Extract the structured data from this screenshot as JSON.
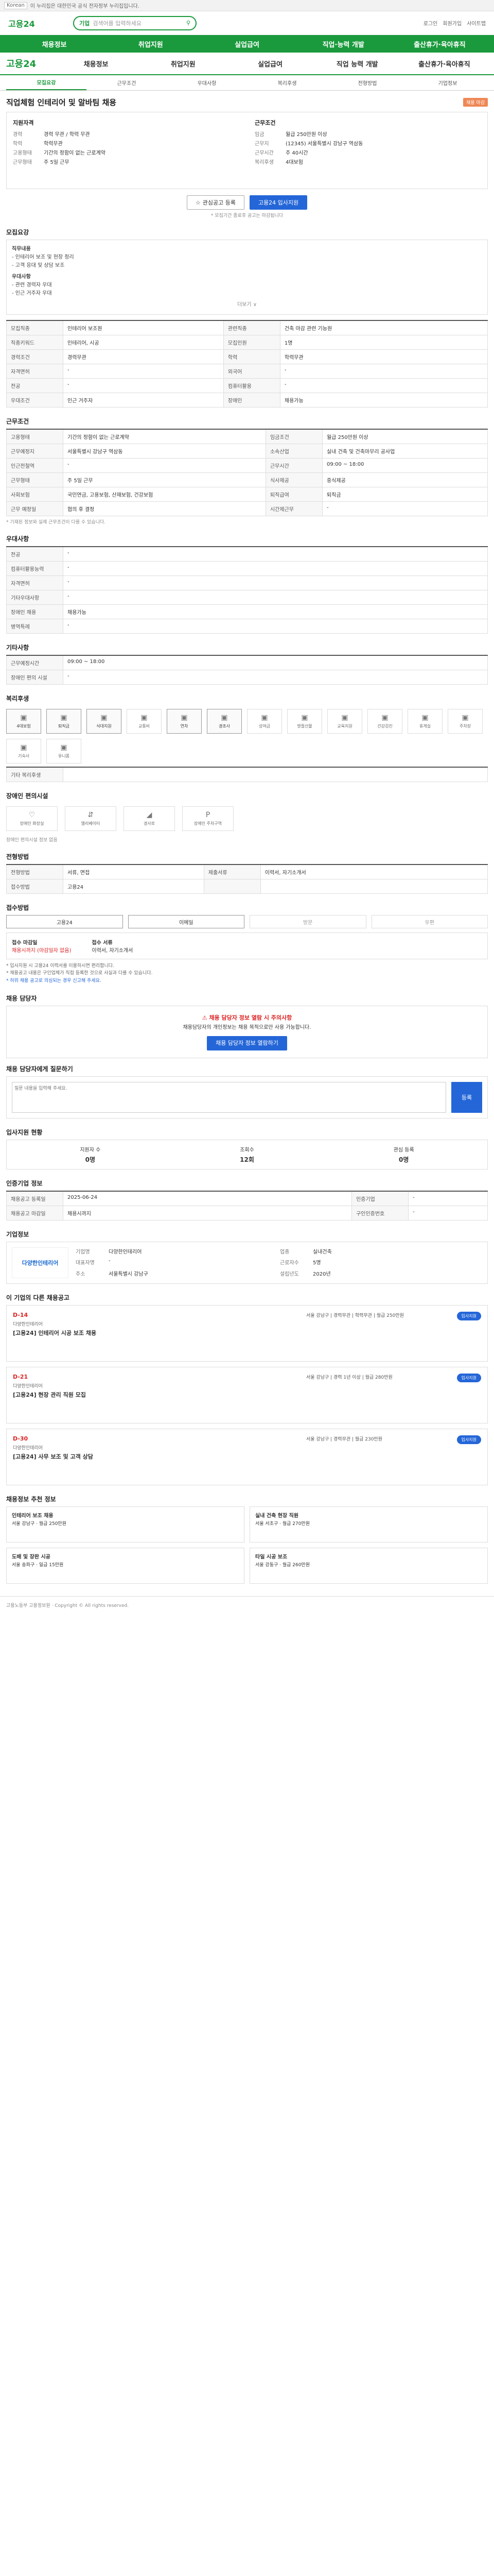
{
  "topbar": {
    "text": "이 누리집은 대한민국 공식 전자정부 누리집입니다.",
    "mini": "Korean"
  },
  "header": {
    "logo": "고용24",
    "search_label": "기업",
    "search_placeholder": "검색어를 입력하세요",
    "links": [
      "로그인",
      "회원가입",
      "사이트맵"
    ]
  },
  "nav": [
    "채용정보",
    "취업지원",
    "실업급여",
    "직업·능력 개발",
    "출산휴가·육아휴직"
  ],
  "gnb": {
    "brand": "고용24",
    "items": [
      "채용정보",
      "취업지원",
      "실업급여",
      "직업 능력 개발",
      "출산휴가·육아휴직"
    ]
  },
  "tabs": [
    "모집요강",
    "근무조건",
    "우대사항",
    "복리후생",
    "전형방법",
    "기업정보"
  ],
  "job": {
    "title": "직업체험 인테리어 및 알바팀 채용",
    "badge": "채용 마감",
    "left_title": "지원자격",
    "left": [
      {
        "k": "경력",
        "v": "경력 무관 / 학력 무관"
      },
      {
        "k": "학력",
        "v": "학력무관"
      },
      {
        "k": "고용형태",
        "v": "기간의 정함이 없는 근로계약"
      },
      {
        "k": "근무형태",
        "v": "주 5일 근무"
      }
    ],
    "right_title": "근무조건",
    "right": [
      {
        "k": "임금",
        "v": "월급 250만원 이상"
      },
      {
        "k": "근무지",
        "v": "(12345) 서울특별시 강남구 역삼동"
      },
      {
        "k": "근무시간",
        "v": "주 40시간"
      },
      {
        "k": "복리후생",
        "v": "4대보험"
      }
    ],
    "scrap_button": "관심공고 등록",
    "apply_button": "고용24 입사지원",
    "note": "* 모집기간 종료후 공고는 마감됩니다"
  },
  "sections": {
    "recruit": "모집요강",
    "recruit_text": [
      "직무내용",
      "- 인테리어 보조 및 현장 정리",
      "- 고객 응대 및 상담 보조",
      "우대사항",
      "- 관련 경력자 우대",
      "- 인근 거주자 우대"
    ],
    "recruit_foot": "더보기 ∨",
    "recruit_table": [
      {
        "k": "모집직종",
        "v": "인테리어 보조원",
        "k2": "관련직종",
        "v2": "건축 마감 관련 기능원"
      },
      {
        "k": "직종키워드",
        "v": "인테리어, 시공",
        "k2": "모집인원",
        "v2": "1명"
      },
      {
        "k": "경력조건",
        "v": "경력무관",
        "k2": "학력",
        "v2": "학력무관"
      },
      {
        "k": "자격면허",
        "v": "-",
        "k2": "외국어",
        "v2": "-"
      },
      {
        "k": "전공",
        "v": "-",
        "k2": "컴퓨터활용",
        "v2": "-"
      },
      {
        "k": "우대조건",
        "v": "인근 거주자",
        "k2": "장애인",
        "v2": "채용가능"
      }
    ],
    "work": "근무조건",
    "work_table": [
      {
        "k": "고용형태",
        "v": "기간의 정함이 없는 근로계약",
        "k2": "임금조건",
        "v2": "월급 250만원 이상"
      },
      {
        "k": "근무예정지",
        "v": "서울특별시 강남구 역삼동",
        "k2": "소속산업",
        "v2": "실내 건축 및 건축마무리 공사업"
      },
      {
        "k": "인근전철역",
        "v": "-",
        "k2": "근무시간",
        "v2": "09:00 ~ 18:00"
      },
      {
        "k": "근무형태",
        "v": "주 5일 근무",
        "k2": "식사제공",
        "v2": "중식제공"
      },
      {
        "k": "사회보험",
        "v": "국민연금, 고용보험, 산재보험, 건강보험",
        "k2": "퇴직급여",
        "v2": "퇴직금"
      },
      {
        "k": "근무 예정일",
        "v": "협의 후 결정",
        "k2": "시간제근무",
        "v2": "-"
      }
    ],
    "work_note": "* 기재된 정보와 실제 근무조건이 다를 수 있습니다.",
    "benefit": "우대사항",
    "benefit_table": [
      {
        "k": "전공",
        "v": "-"
      },
      {
        "k": "컴퓨터활용능력",
        "v": "-"
      },
      {
        "k": "자격면허",
        "v": "-"
      },
      {
        "k": "기타우대사항",
        "v": "-"
      },
      {
        "k": "장애인 채용",
        "v": "채용가능"
      },
      {
        "k": "병역특례",
        "v": "-"
      }
    ],
    "etc": "기타사항",
    "etc_table": [
      {
        "k": "근무예정시간",
        "v": "09:00 ~ 18:00"
      },
      {
        "k": "장애인 편의 시설",
        "v": "-"
      }
    ],
    "welfare": "복리후생",
    "welfare_icons": [
      "4대보험",
      "퇴직금",
      "식대지원",
      "교통비",
      "연차",
      "경조사",
      "상여금",
      "명절선물",
      "교육지원",
      "건강검진",
      "휴게실",
      "주차장",
      "기숙사",
      "유니폼"
    ],
    "welfare_on": [
      0,
      1,
      2,
      4,
      5
    ],
    "welfare_etc": "기타 복리후생",
    "disabled": "장애인 편의시설",
    "disabled_icons": [
      "장애인 화장실",
      "엘리베이터",
      "경사로",
      "장애인 주차구역"
    ],
    "disabled_note": "장애인 편의시설 정보 없음",
    "process": "전형방법",
    "process_table": [
      {
        "k": "전형방법",
        "v": "서류, 면접",
        "k2": "제출서류",
        "v2": "이력서, 자기소개서"
      },
      {
        "k": "접수방법",
        "v": "고용24",
        "k2": "",
        "v2": ""
      }
    ],
    "apply": "접수방법",
    "methods": [
      "고용24",
      "이메일",
      "방문",
      "우편"
    ],
    "methods_on": [
      0,
      1
    ],
    "apply_left_k": "접수 마감일",
    "apply_left_v": "채용시까지 (마감일자 없음)",
    "apply_right_k": "접수 서류",
    "apply_right_v": "이력서, 자기소개서",
    "apply_notes": [
      "* 입사지원 시 고용24 이력서를 이용하시면 편리합니다.",
      "* 채용공고 내용은 구인업체가 직접 등록한 것으로 사실과 다를 수 있습니다.",
      "* 허위 채용 공고로 의심되는 경우 신고해 주세요."
    ],
    "contact": "채용 담당자",
    "warn_title": "채용 담당자 정보 열람 시 주의사항",
    "warn_text": "채용담당자의 개인정보는 채용 목적으로만 사용 가능합니다.",
    "warn_buttons": [
      "채용 담당자 정보 열람하기"
    ],
    "qa": "채용 담당자에게 질문하기",
    "qa_placeholder": "질문 내용을 입력해 주세요.",
    "qa_send": "등록",
    "status": "입사지원 현황",
    "status_items": [
      {
        "k": "지원자 수",
        "v": "0명"
      },
      {
        "k": "조회수",
        "v": "12회"
      },
      {
        "k": "관심 등록",
        "v": "0명"
      }
    ],
    "info": "인증기업 정보",
    "info_table": [
      {
        "k": "채용공고 등록일",
        "v": "2025-06-24",
        "k2": "인증기업",
        "v2": "-"
      },
      {
        "k": "채용공고 마감일",
        "v": "채용시까지",
        "k2": "구인인증번호",
        "v2": "-"
      }
    ],
    "company": "기업정보",
    "company_logo": "다양한인테리어",
    "company_info": [
      {
        "k": "기업명",
        "v": "다양한인테리어"
      },
      {
        "k": "업종",
        "v": "실내건축"
      },
      {
        "k": "대표자명",
        "v": "-"
      },
      {
        "k": "근로자수",
        "v": "5명"
      },
      {
        "k": "주소",
        "v": "서울특별시 강남구"
      },
      {
        "k": "설립년도",
        "v": "2020년"
      }
    ],
    "related": "이 기업의 다른 채용공고",
    "jobs": [
      {
        "due": "D-14",
        "co": "다양한인테리어",
        "title": "[고용24] 인테리어 시공 보조 채용",
        "mid": "서울 강남구 | 경력무관 | 학력무관 | 월급 250만원",
        "p": "입사지원"
      },
      {
        "due": "D-21",
        "co": "다양한인테리어",
        "title": "[고용24] 현장 관리 직원 모집",
        "mid": "서울 강남구 | 경력 1년 이상 | 월급 280만원",
        "p": "입사지원"
      },
      {
        "due": "D-30",
        "co": "다양한인테리어",
        "title": "[고용24] 사무 보조 및 고객 상담",
        "mid": "서울 강남구 | 경력무관 | 월급 230만원",
        "p": "입사지원"
      }
    ],
    "rel_title": "채용정보 추천 정보",
    "rel": [
      {
        "t": "인테리어 보조 채용",
        "d": "서울 강남구 · 월급 250만원"
      },
      {
        "t": "실내 건축 현장 직원",
        "d": "서울 서초구 · 월급 270만원"
      },
      {
        "t": "도배 및 장판 시공",
        "d": "서울 송파구 · 일급 15만원"
      },
      {
        "t": "타일 시공 보조",
        "d": "서울 강동구 · 월급 260만원"
      }
    ]
  },
  "footer": "고용노동부 고용정보원 · Copyright © All rights reserved."
}
